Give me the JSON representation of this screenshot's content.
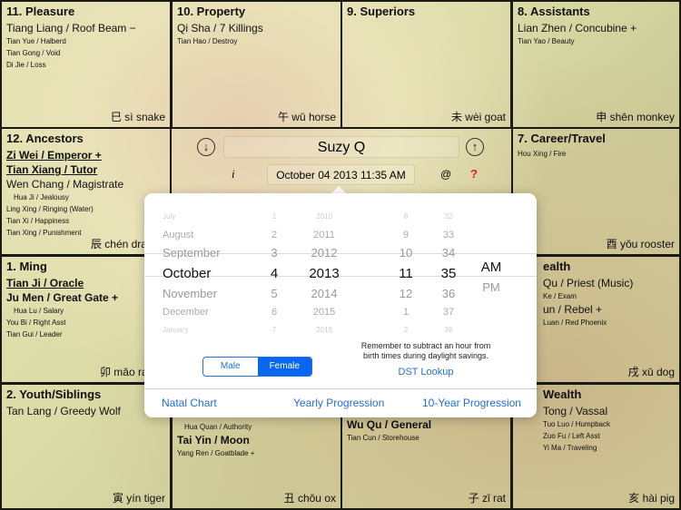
{
  "cells": [
    {
      "title": "11. Pleasure",
      "stars": [
        {
          "t": "Tiang Liang / Roof Beam  −",
          "c": "big"
        },
        {
          "t": "Tian Yue / Halberd",
          "c": "sm"
        },
        {
          "t": "Tian Gong / Void",
          "c": "sm"
        },
        {
          "t": "Di Jie / Loss",
          "c": "sm"
        }
      ],
      "branch": "巳 sì snake"
    },
    {
      "title": "10. Property",
      "stars": [
        {
          "t": "Qi Sha / 7 Killings",
          "c": "big"
        },
        {
          "t": "Tian Hao / Destroy",
          "c": "sm"
        }
      ],
      "branch": "午 wǔ horse"
    },
    {
      "title": "9. Superiors",
      "stars": [],
      "branch": "未 wèi goat"
    },
    {
      "title": "8. Assistants",
      "stars": [
        {
          "t": "Lian Zhen / Concubine  +",
          "c": "big"
        },
        {
          "t": "Tian Yao / Beauty",
          "c": "sm"
        }
      ],
      "branch": "申 shēn monkey"
    },
    {
      "title": "12. Ancestors",
      "stars": [
        {
          "t": "Zi Wei / Emperor  +",
          "c": "big bold"
        },
        {
          "t": "Tian Xiang / Tutor",
          "c": "big bold"
        },
        {
          "t": "Wen Chang / Magistrate",
          "c": "big"
        },
        {
          "t": "Hua Ji / Jealousy",
          "c": "sm ind"
        },
        {
          "t": "Ling Xing / Ringing (Water)",
          "c": "sm"
        },
        {
          "t": "Tian Xi / Happiness",
          "c": "sm"
        },
        {
          "t": "Tian Xing / Punishment",
          "c": "sm"
        }
      ],
      "branch": "辰 chén dragon"
    },
    {
      "title": "7. Career/Travel",
      "stars": [
        {
          "t": "Hou Xing / Fire",
          "c": "sm"
        }
      ],
      "branch": "酉 yǒu rooster"
    },
    {
      "title": "1. Ming",
      "stars": [
        {
          "t": "Tian Ji / Oracle",
          "c": "big bold"
        },
        {
          "t": "Ju Men / Great Gate  +",
          "c": "big bb"
        },
        {
          "t": "Hua Lu / Salary",
          "c": "sm ind"
        },
        {
          "t": "You Bi / Right Asst",
          "c": "sm"
        },
        {
          "t": "Tian Gui / Leader",
          "c": "sm"
        }
      ],
      "branch": "卯 mǎo rabbit"
    },
    {
      "title": "ealth",
      "stars": [
        {
          "t": "Qu / Priest (Music)",
          "c": "big"
        },
        {
          "t": "Ke / Exam",
          "c": "sm"
        },
        {
          "t": "un / Rebel  +",
          "c": "big"
        },
        {
          "t": "Luan / Red Phoenix",
          "c": "sm"
        }
      ],
      "branch": "戌 xū dog"
    },
    {
      "title": "2. Youth/Siblings",
      "stars": [
        {
          "t": "Tan Lang / Greedy Wolf",
          "c": "big"
        }
      ],
      "branch": "寅 yín tiger"
    },
    {
      "title": "",
      "stars": [
        {
          "t": "Hua Quan / Authority",
          "c": "sm ind"
        },
        {
          "t": "Tai Yin / Moon",
          "c": "big bb"
        },
        {
          "t": "Yang Ren / Goatblade  +",
          "c": "sm"
        }
      ],
      "branch": "丑 chǒu ox"
    },
    {
      "title": "",
      "stars": [
        {
          "t": "Wu Qu / General",
          "c": "big bb"
        },
        {
          "t": "Tian Cun / Storehouse",
          "c": "sm"
        }
      ],
      "branch": "子 zǐ rat"
    },
    {
      "title": "Wealth",
      "stars": [
        {
          "t": "Tong / Vassal",
          "c": "big"
        },
        {
          "t": "Tuo Luo / Humpback",
          "c": "sm"
        },
        {
          "t": "Zuo Fu / Left Asst",
          "c": "sm"
        },
        {
          "t": "Yi Ma / Traveling",
          "c": "sm"
        }
      ],
      "branch": "亥 hài pig"
    }
  ],
  "header": {
    "name": "Suzy Q",
    "datetime": "October 04 2013  11:35 AM",
    "info": "i",
    "at": "@",
    "help": "?",
    "prev_icon": "arrow-down-circle",
    "next_icon": "arrow-up-circle"
  },
  "picker": {
    "months": [
      "July",
      "August",
      "September",
      "October",
      "November",
      "December",
      "January"
    ],
    "days": [
      "1",
      "2",
      "3",
      "4",
      "5",
      "6",
      "7"
    ],
    "years": [
      "2010",
      "2011",
      "2012",
      "2013",
      "2014",
      "2015",
      "2016"
    ],
    "hours": [
      "8",
      "9",
      "10",
      "11",
      "12",
      "1",
      "2"
    ],
    "minutes": [
      "32",
      "33",
      "34",
      "35",
      "36",
      "37",
      "38"
    ],
    "ampm": [
      "AM",
      "PM"
    ]
  },
  "gender": {
    "male": "Male",
    "female": "Female",
    "selected": "Female"
  },
  "dst": {
    "note1": "Remember to subtract an hour from",
    "note2": "birth times during daylight savings.",
    "link": "DST Lookup"
  },
  "tabs": [
    "Natal Chart",
    "Yearly Progression",
    "10-Year Progression"
  ],
  "colors": {
    "accent": "#1f6fd6",
    "help": "#e02020"
  }
}
